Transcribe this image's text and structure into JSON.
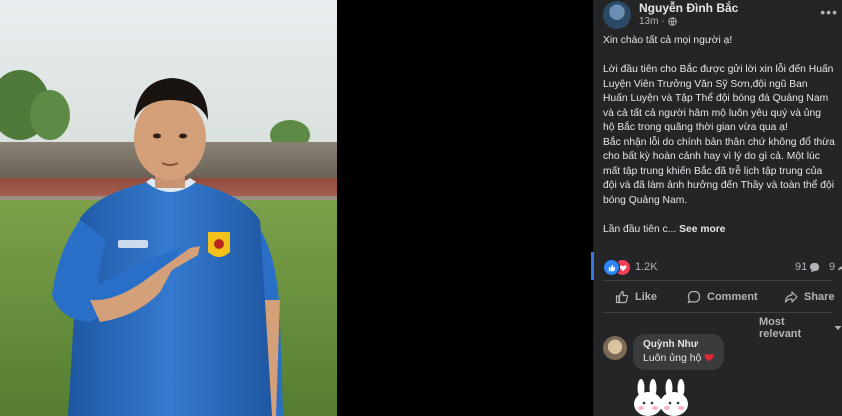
{
  "post": {
    "author": "Nguyễn Đình Bắc",
    "time": "13m",
    "privacy_icon": "globe-icon",
    "paragraphs": [
      "Xin chào tất cả mọi người ạ!",
      "Lời đầu tiên cho Bắc được gửi lời xin lỗi đến Huấn Luyện Viên Trưởng Văn Sỹ Sơn,đội ngũ Ban Huấn Luyện và Tập Thể đội bóng đá Quảng Nam và cả tất cả người hâm mộ luôn yêu quý và ủng hộ Bắc trong quãng thời gian vừa qua ạ!\nBắc nhận lỗi do chính bản thân chứ không đổ thừa cho bất kỳ hoàn cảnh hay vì lý do gì cả. Một lúc mất tập trung khiến Bắc đã trễ lịch tập trung của đội và đã làm ảnh hưởng đến Thầy và toàn thể đội bóng Quảng Nam."
    ],
    "truncated_text": "Lần đầu tiên c...",
    "see_more": "See more"
  },
  "stats": {
    "reaction_count": "1.2K",
    "comment_count": "91",
    "share_count": "9"
  },
  "actions": {
    "like": "Like",
    "comment": "Comment",
    "share": "Share"
  },
  "comments": {
    "sort_label": "Most relevant",
    "items": [
      {
        "name": "Quỳnh Như",
        "text": "Luôn ủng hộ"
      }
    ]
  },
  "colors": {
    "accent": "#2d88ff",
    "love": "#f33e58",
    "panel": "#242526",
    "bubble": "#3a3b3c",
    "jersey": "#2a6fc7"
  }
}
